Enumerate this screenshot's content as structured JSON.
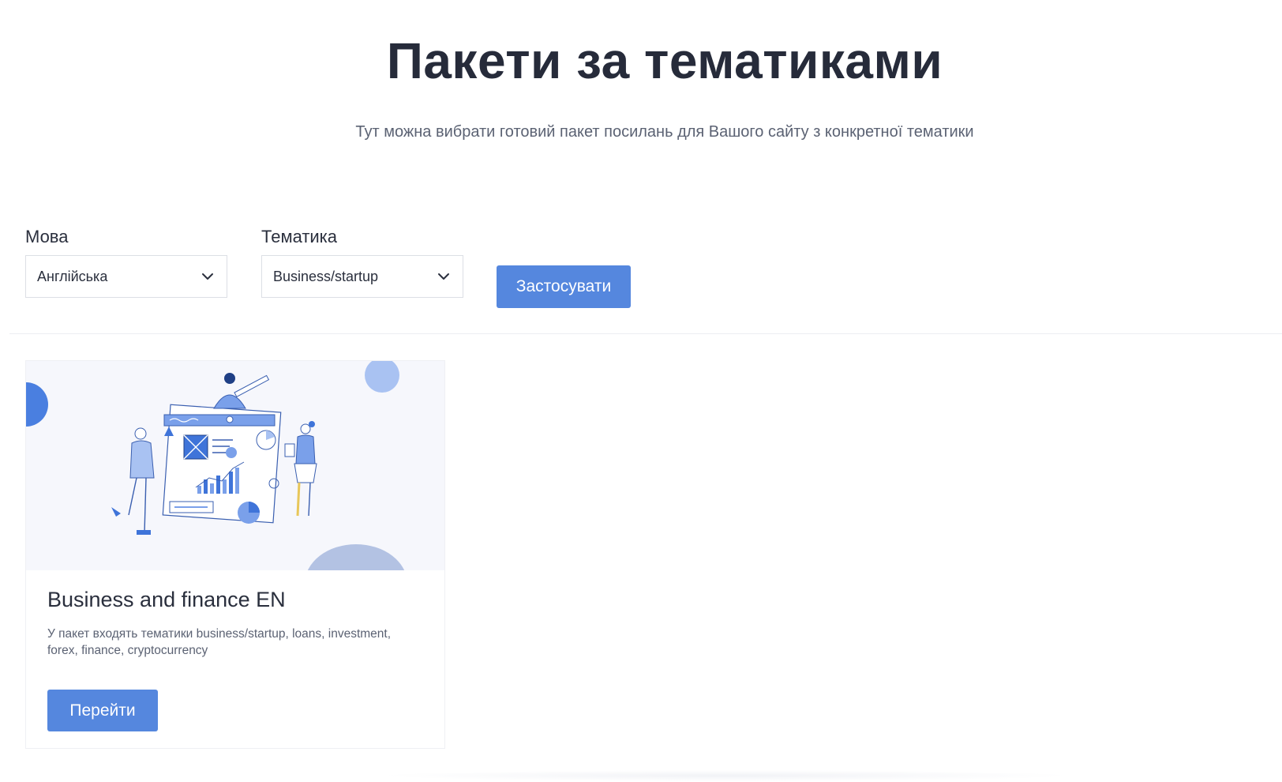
{
  "hero": {
    "title": "Пакети за тематиками",
    "subtitle": "Тут можна вибрати готовий пакет посилань для Вашого сайту з конкретної тематики"
  },
  "filters": {
    "language": {
      "label": "Мова",
      "selected": "Англійська"
    },
    "topic": {
      "label": "Тематика",
      "selected": "Business/startup"
    },
    "apply_label": "Застосувати"
  },
  "packages": [
    {
      "title": "Business and finance EN",
      "description": "У пакет входять тематики business/startup, loans, investment, forex, finance, cryptocurrency",
      "button_label": "Перейти",
      "image_icon": "business-team-illustration-icon"
    }
  ],
  "colors": {
    "accent": "#5587de",
    "title": "#262b3a",
    "muted": "#5b6273",
    "illustration_blue": "#4a7fe0",
    "illustration_light": "#a9c2f2"
  }
}
